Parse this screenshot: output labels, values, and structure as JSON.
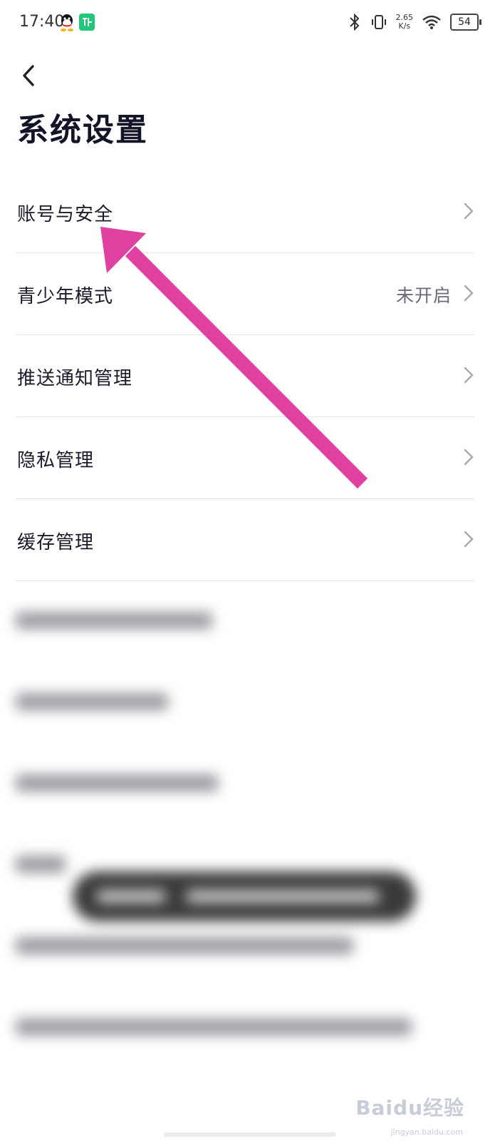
{
  "status_bar": {
    "time": "17:40",
    "network_speed_value": "2.65",
    "network_speed_unit": "K/s",
    "battery_level": "54",
    "icons": [
      "qq-icon",
      "app-icon",
      "bluetooth-icon",
      "vibrate-icon",
      "wifi-icon",
      "battery-icon"
    ]
  },
  "header": {
    "back_icon": "chevron-left-icon",
    "title": "系统设置"
  },
  "settings": [
    {
      "label": "账号与安全",
      "value": ""
    },
    {
      "label": "青少年模式",
      "value": "未开启"
    },
    {
      "label": "推送通知管理",
      "value": ""
    },
    {
      "label": "隐私管理",
      "value": ""
    },
    {
      "label": "缓存管理",
      "value": ""
    }
  ],
  "annotation": {
    "icon": "arrow-icon",
    "color": "#e040a0"
  },
  "watermark": {
    "text": "Baidu经验",
    "sub": "jingyan.baidu.com"
  },
  "colors": {
    "title": "#141428",
    "divider": "#e4e4e4",
    "secondary_text": "#6a6a7a"
  }
}
